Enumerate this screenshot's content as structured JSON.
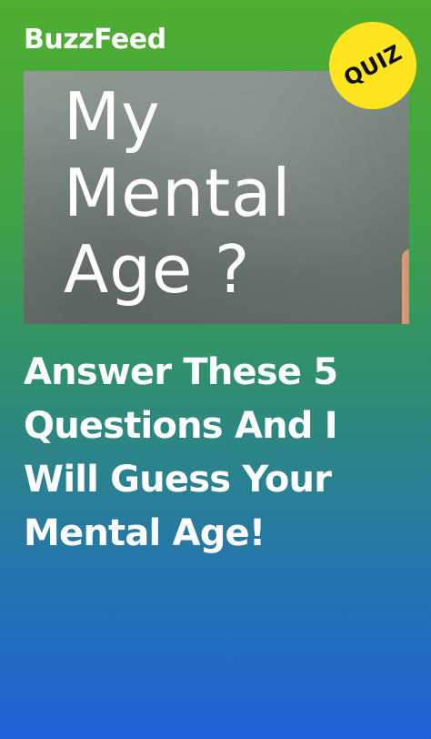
{
  "brand": {
    "name": "BuzzFeed"
  },
  "badge": {
    "label": "QUIZ",
    "color": "#ffe51f"
  },
  "hero": {
    "title_lines": [
      "My",
      "Mental",
      "Age ?"
    ]
  },
  "headline": {
    "lines": [
      "Answer These 5",
      "Questions And I",
      "Will Guess Your",
      "Mental Age!"
    ]
  },
  "colors": {
    "gradient_top": "#4fae2f",
    "gradient_bottom": "#1f62d9",
    "text": "#ffffff"
  }
}
